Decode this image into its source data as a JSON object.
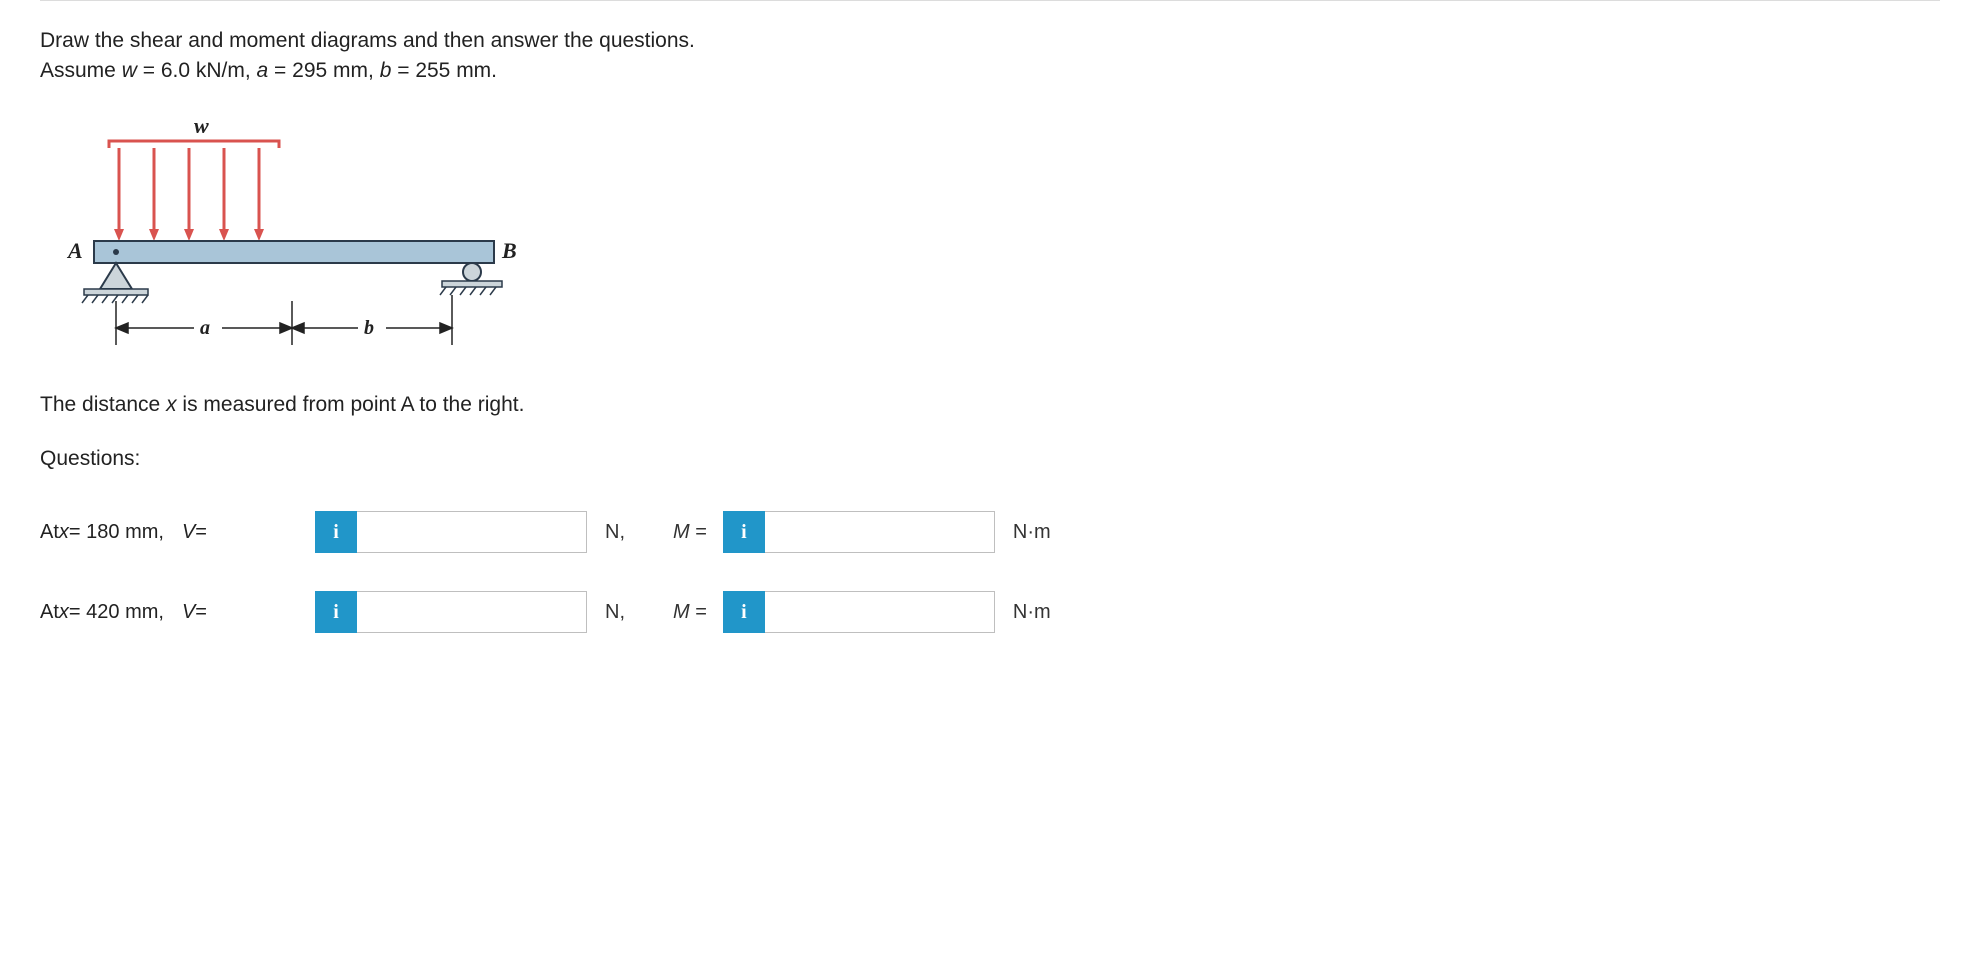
{
  "intro": {
    "line1": "Draw the shear and moment diagrams and then answer the questions.",
    "line2_prefix": "Assume ",
    "w_var": "w",
    "w_val": " = 6.0 kN/m, ",
    "a_var": "a",
    "a_val": " = 295 mm, ",
    "b_var": "b",
    "b_val": " = 255 mm."
  },
  "figure": {
    "w_label": "w",
    "A_label": "A",
    "B_label": "B",
    "a_label": "a",
    "b_label": "b"
  },
  "note": {
    "prefix": "The distance ",
    "x_var": "x",
    "suffix": " is measured from point A to the right."
  },
  "questions_label": "Questions:",
  "rows": [
    {
      "x_prefix": "At ",
      "x_var": "x",
      "x_val": " = 180 mm,",
      "V_var": "V",
      "eq": " =",
      "unit_v": "N,",
      "M_var": "M",
      "M_eq": " =",
      "unit_m": "N·m"
    },
    {
      "x_prefix": "At ",
      "x_var": "x",
      "x_val": " = 420 mm,",
      "V_var": "V",
      "eq": " =",
      "unit_v": "N,",
      "M_var": "M",
      "M_eq": " =",
      "unit_m": "N·m"
    }
  ],
  "info_icon": "i"
}
